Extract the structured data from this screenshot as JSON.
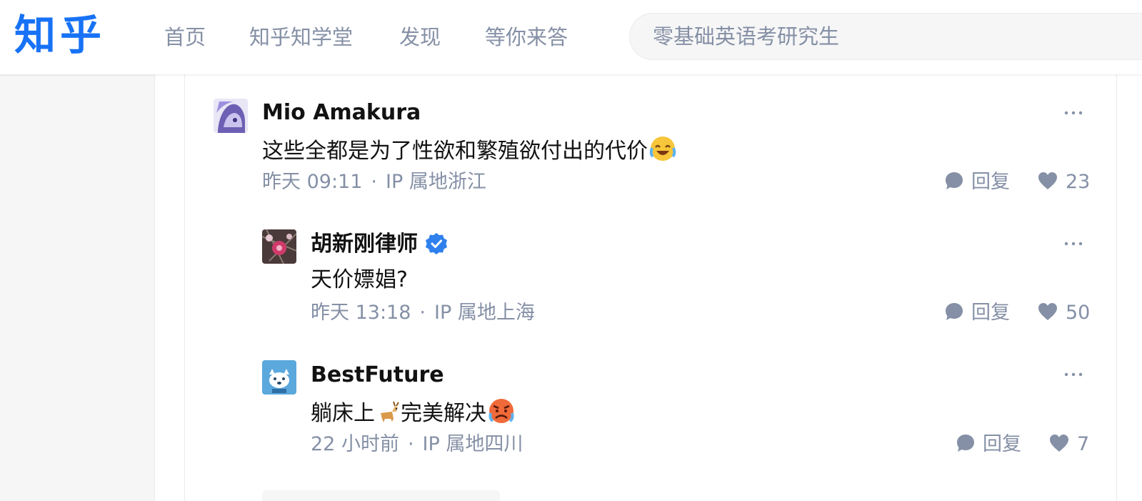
{
  "header": {
    "logo": "知乎",
    "nav": [
      "首页",
      "知乎知学堂",
      "发现",
      "等你来答"
    ],
    "search_placeholder": "零基础英语考研究生",
    "brand_color": "#1772f6"
  },
  "comments": [
    {
      "author": "Mio Amakura",
      "content": "这些全都是为了性欲和繁殖欲付出的代价",
      "emoji": "laugh-cry-emoji",
      "time": "昨天 09:11",
      "ip": "IP 属地浙江",
      "reply_label": "回复",
      "likes": "23"
    },
    {
      "author": "胡新刚律师",
      "verified": true,
      "content": "天价嫖娼?",
      "time": "昨天 13:18",
      "ip": "IP 属地上海",
      "reply_label": "回复",
      "likes": "50"
    },
    {
      "author": "BestFuture",
      "content_parts": [
        "躺床上",
        "完美解决"
      ],
      "emojis": [
        "goat-emoji",
        "angry-sweat-emoji"
      ],
      "time": "22 小时前",
      "ip": "IP 属地四川",
      "reply_label": "回复",
      "likes": "7"
    }
  ],
  "separator": "·"
}
